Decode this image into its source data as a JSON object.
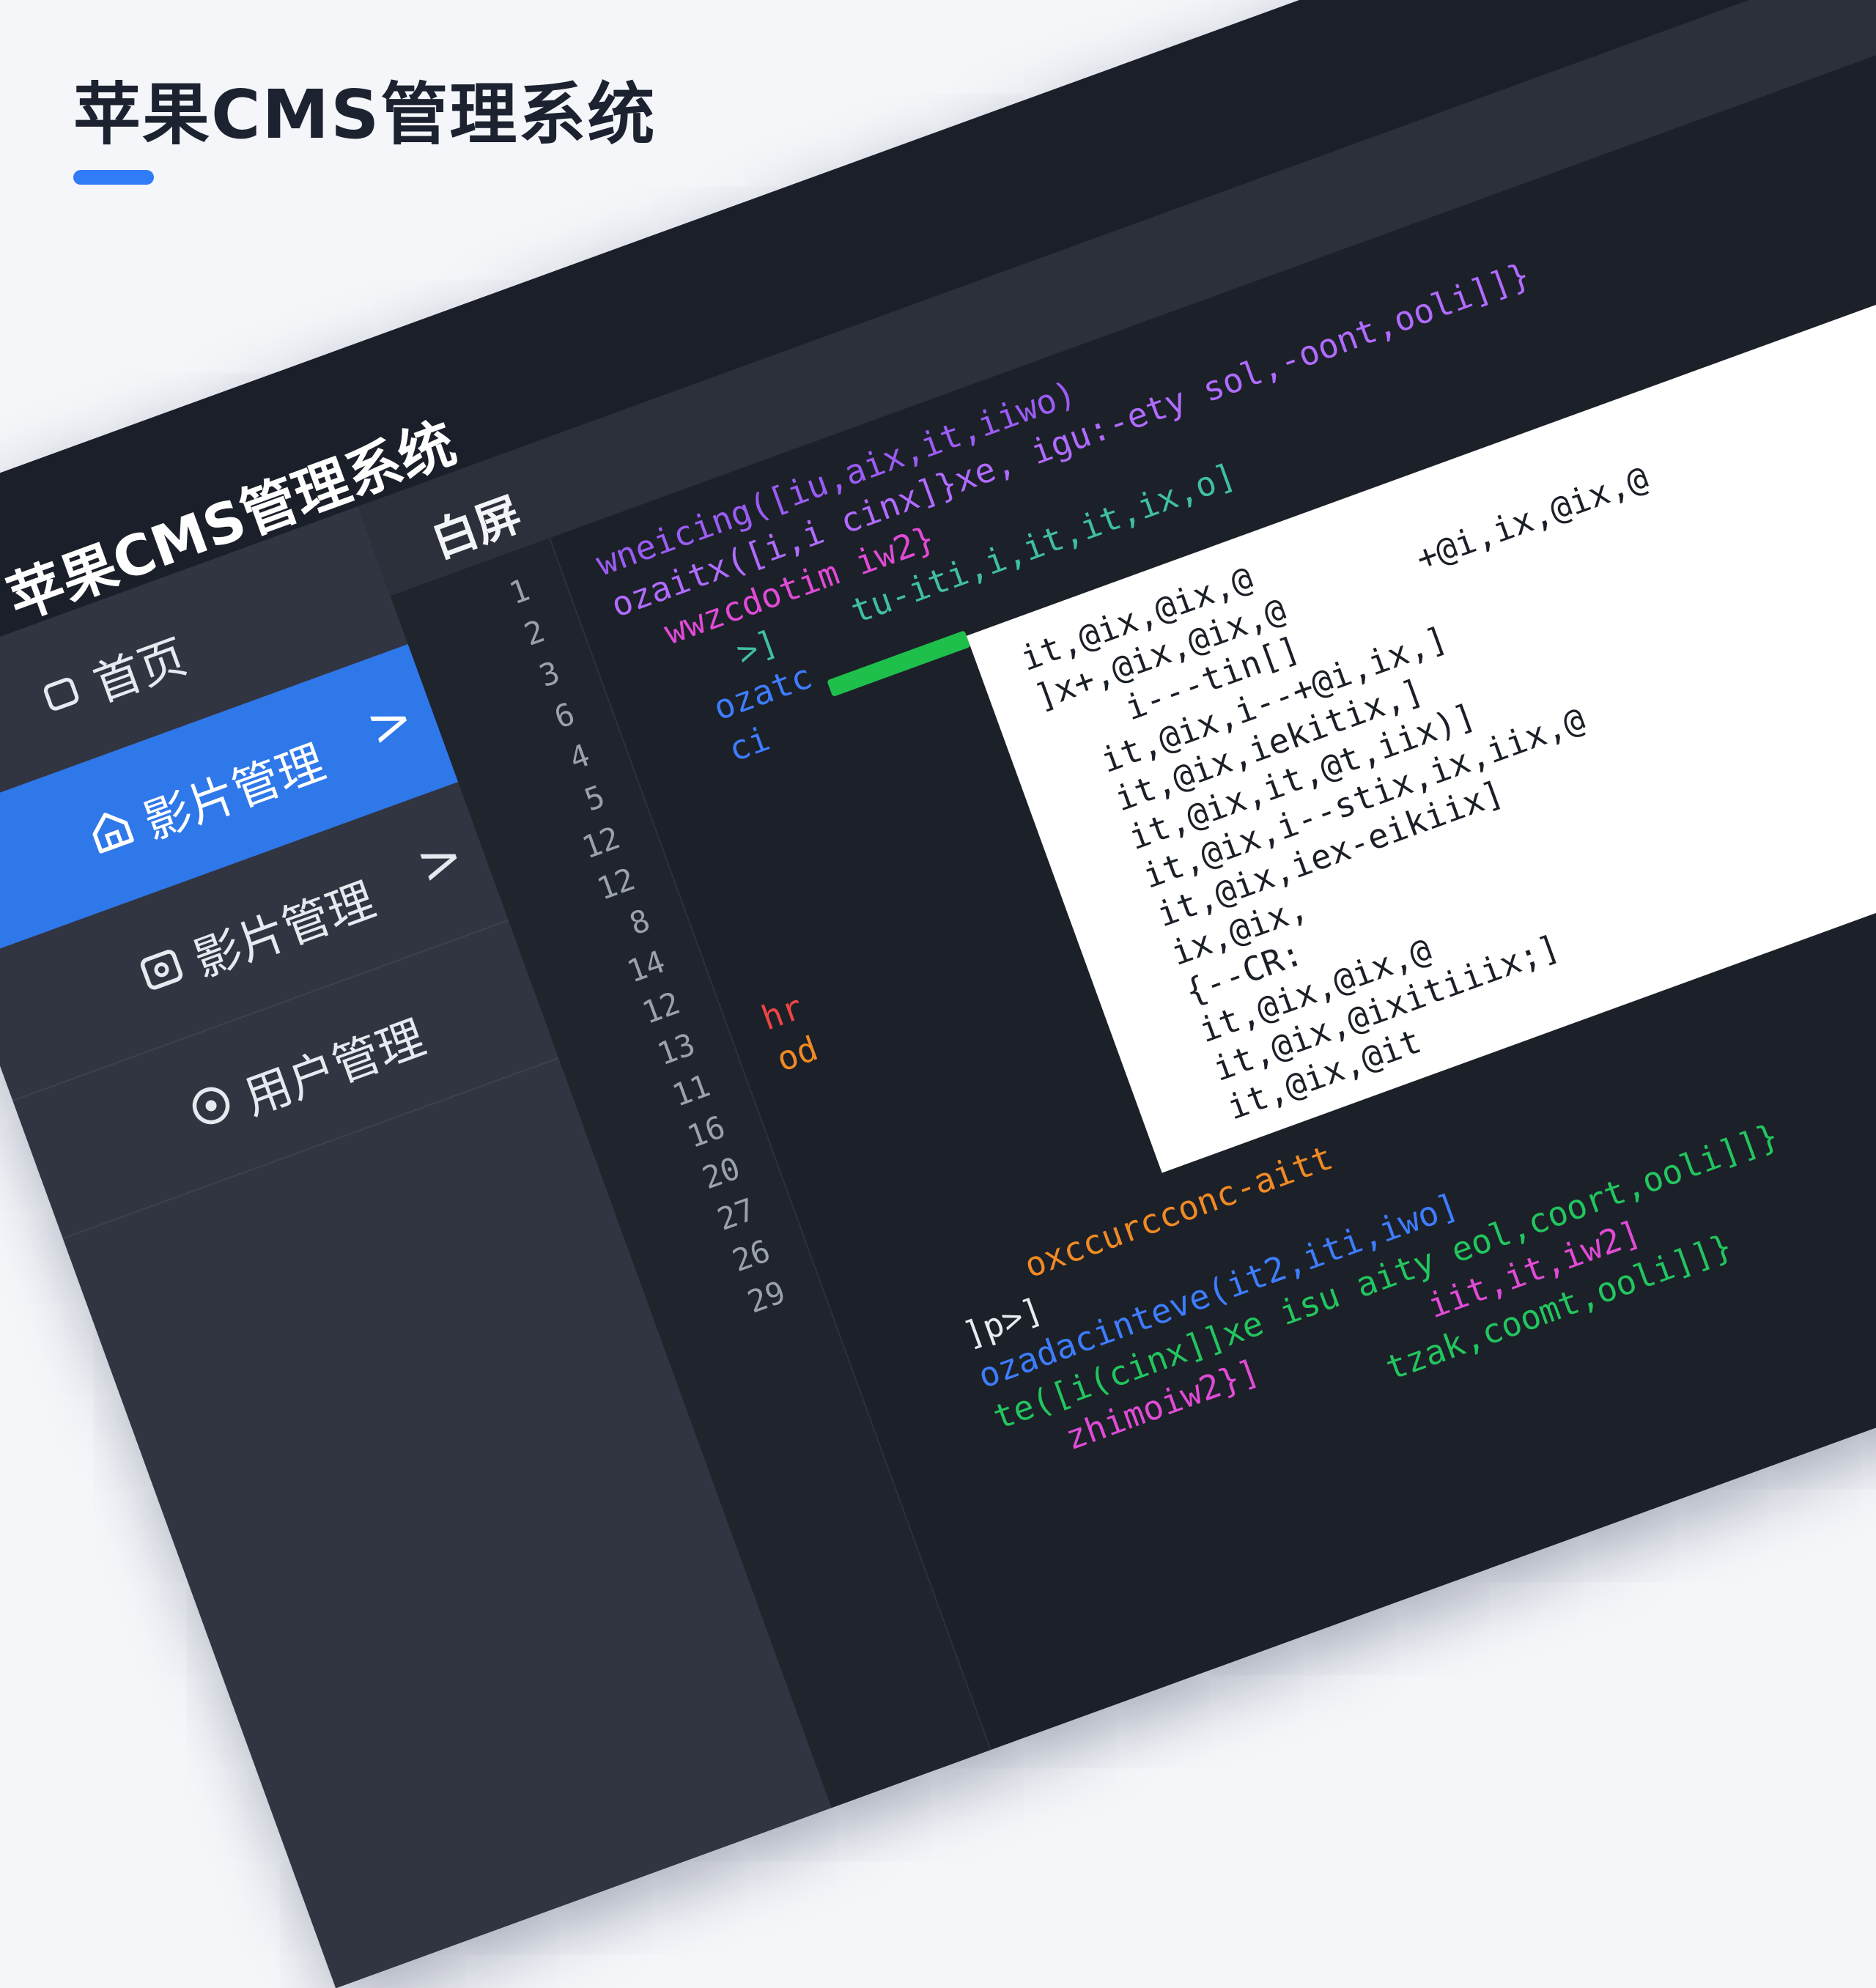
{
  "page": {
    "heading": "苹果CMS管理系统",
    "accent_color": "#2f7cf6"
  },
  "app": {
    "title": "苹果CMS管理系统",
    "sidebar": {
      "items": [
        {
          "label": "首页",
          "icon": "home-icon",
          "active": false,
          "arrow": ""
        },
        {
          "label": "影片管理",
          "icon": "house-icon",
          "active": true,
          "arrow": ">"
        },
        {
          "label": "影片管理",
          "icon": "box-icon",
          "active": false,
          "arrow": ">"
        },
        {
          "label": "用户管理",
          "icon": "target-icon",
          "active": false,
          "arrow": ""
        }
      ]
    },
    "tab": {
      "label": "白屏"
    },
    "editor": {
      "line_numbers": [
        "1",
        "2",
        "3",
        "6",
        "4",
        "5",
        "12",
        "12",
        "8",
        "14",
        "12",
        "13",
        "11",
        "16",
        "20",
        "27",
        "26",
        "29"
      ],
      "code_lines": [
        "wneicing([iu,aix,it,iiwo)",
        "ozaitx([i,i cinx]}xe, igu:-ety sol,-oont,ooli]]}",
        "  wwzcdotim iw2}",
        "     >]    tu-iti,i,it,it,ix,o]",
        "   ozatc",
        "   ci",
        "hr",
        "od",
        "        oxccurcconc-aitt",
        "    ]p>]",
        "    ozadacinteve(it2,iti,iwo]",
        "    te([i(cinx]]xe isu aity eol,coort,ooli]]}",
        "       zhimoiw2}]         iit,it,iw2]",
        "                       tzak,coomt,ooli]]}"
      ],
      "white_panel_lines": [
        "it,@ix,@ix,@",
        "]x+,@ix,@ix,@       +@i,ix,@ix,@",
        "    i---tin[]",
        "  it,@ix,i--+@i,ix,]",
        "  it,@ix,iekitix,]",
        "  it,@ix,it,@t,iix)]",
        "  it,@ix,i--stix,ix,iix,@",
        "  it,@ix,iex-eikiix]",
        "  ix,@ix,",
        "  {--CR:",
        "  it,@ix,@ix,@",
        "  it,@ix,@ixitiiix;]",
        "  it,@ix,@it"
      ]
    }
  }
}
